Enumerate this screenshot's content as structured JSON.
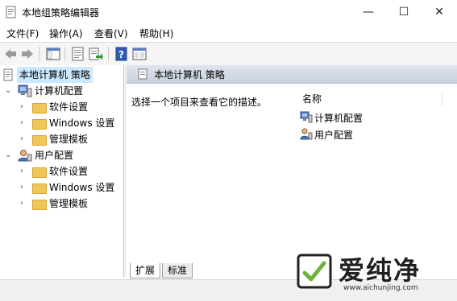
{
  "window": {
    "title": "本地组策略编辑器",
    "minimize_glyph": "—",
    "maximize_glyph": "☐",
    "close_glyph": "✕"
  },
  "menu": [
    "文件(F)",
    "操作(A)",
    "查看(V)",
    "帮助(H)"
  ],
  "toolbar": {
    "buttons": [
      "back-icon",
      "forward-icon",
      "show-hide-tree-icon",
      "properties-icon",
      "export-list-icon",
      "help-icon",
      "extended-view-icon"
    ]
  },
  "tree": {
    "root": "本地计算机 策略",
    "computer_config": "计算机配置",
    "user_config": "用户配置",
    "software_settings": "软件设置",
    "windows_settings": "Windows 设置",
    "admin_templates": "管理模板"
  },
  "right_pane": {
    "header": "本地计算机 策略",
    "description": "选择一个项目来查看它的描述。",
    "column_name": "名称",
    "items": [
      "计算机配置",
      "用户配置"
    ]
  },
  "tabs": [
    "扩展",
    "标准"
  ],
  "watermark": {
    "brand": "爱纯净",
    "url": "www.aichunjing.com"
  },
  "colors": {
    "header_gradient_top": "#dfe5ee",
    "folder": "#f0c65a",
    "selection": "#cce8ff"
  }
}
